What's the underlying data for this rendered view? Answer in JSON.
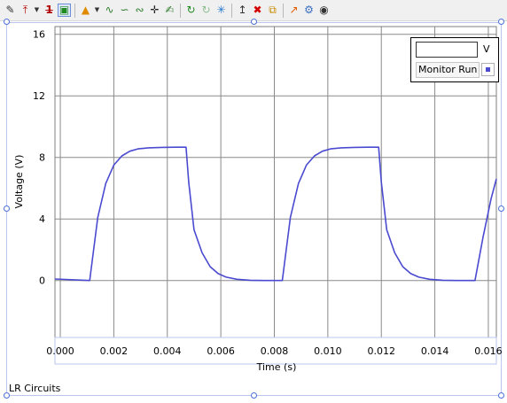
{
  "toolbar": {
    "buttons": [
      {
        "icon": "pencil-edit-icon"
      },
      {
        "icon": "graph-up-arrow-icon"
      },
      {
        "icon": "red-one-icon"
      },
      {
        "icon": "autoscale-icon"
      },
      {
        "icon": "triangle-shapes-icon"
      },
      {
        "icon": "add-curve-fit-icon"
      },
      {
        "icon": "curve-icon"
      },
      {
        "icon": "curve-remove-icon"
      },
      {
        "icon": "crosshair-icon"
      },
      {
        "icon": "draw-prediction-icon"
      },
      {
        "icon": "refresh-green-icon"
      },
      {
        "icon": "refresh-faded-icon"
      },
      {
        "icon": "sparkle-icon"
      },
      {
        "icon": "text-up-arrow-icon"
      },
      {
        "icon": "delete-x-icon"
      },
      {
        "icon": "copy-layers-icon"
      },
      {
        "icon": "pin-icon"
      },
      {
        "icon": "gear-icon"
      },
      {
        "icon": "eye-icon"
      }
    ]
  },
  "legend": {
    "input_value": "",
    "unit": "V",
    "series_label": "Monitor Run",
    "series_color": "#4a4ad0"
  },
  "caption": "LR Circuits",
  "chart_data": {
    "type": "line",
    "xlabel": "Time (s)",
    "ylabel": "Voltage (V)",
    "xlim": [
      -0.0002,
      0.0163
    ],
    "ylim": [
      -3.7,
      16.5
    ],
    "xticks": [
      "0.000",
      "0.002",
      "0.004",
      "0.006",
      "0.008",
      "0.010",
      "0.012",
      "0.014",
      "0.016"
    ],
    "yticks": [
      "0",
      "4",
      "8",
      "12",
      "16"
    ],
    "grid": true,
    "legend_position": "top-right",
    "series": [
      {
        "name": "Monitor Run",
        "color": "#4a4ad0",
        "x": [
          -0.0002,
          0.0011,
          0.0014,
          0.0017,
          0.002,
          0.0023,
          0.0026,
          0.0029,
          0.0033,
          0.0038,
          0.0043,
          0.0047,
          0.0048,
          0.005,
          0.0053,
          0.0056,
          0.0059,
          0.0062,
          0.0066,
          0.0071,
          0.0076,
          0.0083,
          0.0086,
          0.0089,
          0.0092,
          0.0095,
          0.0098,
          0.0101,
          0.0105,
          0.011,
          0.0115,
          0.0119,
          0.012,
          0.0122,
          0.0125,
          0.0128,
          0.0131,
          0.0134,
          0.0138,
          0.0143,
          0.0148,
          0.0155,
          0.0158,
          0.0161,
          0.0163
        ],
        "y": [
          0.1,
          0.0,
          4.1,
          6.3,
          7.5,
          8.1,
          8.4,
          8.55,
          8.62,
          8.65,
          8.66,
          8.66,
          6.4,
          3.3,
          1.8,
          0.9,
          0.45,
          0.22,
          0.08,
          0.02,
          0.0,
          0.0,
          4.1,
          6.3,
          7.5,
          8.1,
          8.4,
          8.55,
          8.62,
          8.65,
          8.66,
          8.66,
          6.4,
          3.3,
          1.8,
          0.9,
          0.45,
          0.22,
          0.08,
          0.02,
          0.0,
          0.0,
          2.8,
          5.3,
          6.6
        ]
      }
    ]
  }
}
